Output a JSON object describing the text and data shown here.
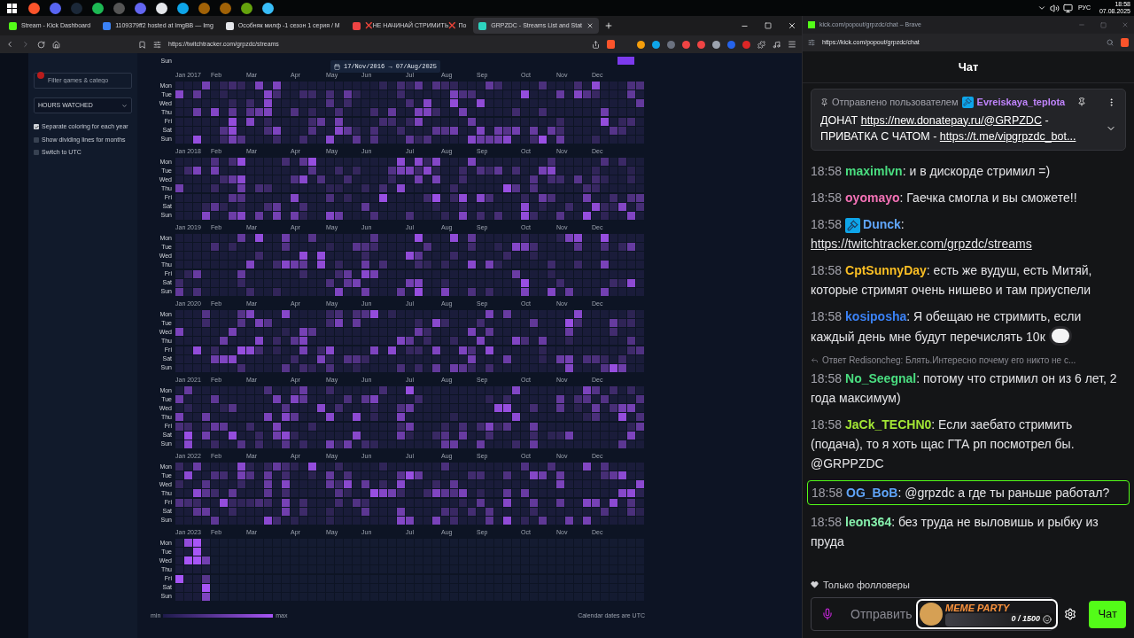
{
  "taskbar": {
    "language": "РУС",
    "time": "18:58",
    "date": "07.08.2025"
  },
  "browser": {
    "tabs": [
      {
        "title": "Stream - Kick Dashboard",
        "selected": false,
        "color": "#53fc18"
      },
      {
        "title": "1109379ff2 hosted at ImgBB — Img",
        "selected": false,
        "color": "#3b82f6"
      },
      {
        "title": "Особняк милф -1 сезон 1 серия / M",
        "selected": false,
        "color": "#e5e7eb"
      },
      {
        "title": "❌НЕ НАЧИНАЙ СТРИМИТЬ❌ По",
        "selected": false,
        "color": "#ef4444"
      },
      {
        "title": "GRPZDC - Streams List and Stat",
        "selected": true,
        "color": "#2dd4bf"
      }
    ],
    "url": "https://twitchtracker.com/grpzdc/streams"
  },
  "sidebar": {
    "filter_placeholder": "Filter games & catego",
    "metric": "HOURS WATCHED",
    "options": [
      {
        "label": "Separate coloring for each year",
        "checked": true
      },
      {
        "label": "Show dividing lines for months",
        "checked": false
      },
      {
        "label": "Switch to UTC",
        "checked": false
      }
    ]
  },
  "calendar": {
    "date_range": "17/Nov/2016 → 07/Aug/2025",
    "tail_day": "Sun",
    "years": [
      {
        "kind": "full",
        "months": [
          "Jan 2017",
          "Feb",
          "Mar",
          "Apr",
          "May",
          "Jun",
          "Jul",
          "Aug",
          "Sep",
          "Oct",
          "Nov",
          "Dec"
        ],
        "days": [
          "Mon",
          "Tue",
          "Wed",
          "Thu",
          "Fri",
          "Sat",
          "Sun"
        ]
      },
      {
        "kind": "full",
        "months": [
          "Jan 2018",
          "Feb",
          "Mar",
          "Apr",
          "May",
          "Jun",
          "Jul",
          "Aug",
          "Sep",
          "Oct",
          "Nov",
          "Dec"
        ],
        "days": [
          "Mon",
          "Tue",
          "Wed",
          "Thu",
          "Fri",
          "Sat",
          "Sun"
        ]
      },
      {
        "kind": "full",
        "months": [
          "Jan 2019",
          "Feb",
          "Mar",
          "Apr",
          "May",
          "Jun",
          "Jul",
          "Aug",
          "Sep",
          "Oct",
          "Nov",
          "Dec"
        ],
        "days": [
          "Mon",
          "Tue",
          "Wed",
          "Thu",
          "Fri",
          "Sat",
          "Sun"
        ]
      },
      {
        "kind": "full",
        "months": [
          "Jan 2020",
          "Feb",
          "Mar",
          "Apr",
          "May",
          "Jun",
          "Jul",
          "Aug",
          "Sep",
          "Oct",
          "Nov",
          "Dec"
        ],
        "days": [
          "Mon",
          "Tue",
          "Wed",
          "Thu",
          "Fri",
          "Sat",
          "Sun"
        ]
      },
      {
        "kind": "full",
        "months": [
          "Jan 2021",
          "Feb",
          "Mar",
          "Apr",
          "May",
          "Jun",
          "Jul",
          "Aug",
          "Sep",
          "Oct",
          "Nov",
          "Dec"
        ],
        "days": [
          "Mon",
          "Tue",
          "Wed",
          "Thu",
          "Fri",
          "Sat",
          "Sun"
        ]
      },
      {
        "kind": "full",
        "months": [
          "Jan 2022",
          "Feb",
          "Mar",
          "Apr",
          "May",
          "Jun",
          "Jul",
          "Aug",
          "Sep",
          "Oct",
          "Nov",
          "Dec"
        ],
        "days": [
          "Mon",
          "Tue",
          "Wed",
          "Thu",
          "Fri",
          "Sat",
          "Sun"
        ]
      },
      {
        "kind": "partial",
        "months": [
          "Jan 2023",
          "Feb",
          "Mar",
          "Apr",
          "May",
          "Jun",
          "Jul",
          "Aug",
          "Sep",
          "Oct",
          "Nov",
          "Dec"
        ],
        "days": [
          "Mon",
          "Tue",
          "Wed",
          "Thu",
          "Fri",
          "Sat",
          "Sun"
        ]
      }
    ],
    "legend_min": "min",
    "legend_max": "max",
    "note": "Calendar dates are UTC"
  },
  "chat": {
    "window_title": "kick.com/popout/grpzdc/chat – Brave",
    "url": "https://kick.com/popout/grpzdc/chat",
    "header": "Чат",
    "pinned": {
      "prefix": "Отправлено пользователем",
      "user": "Evreiskaya_teplota",
      "parts": [
        {
          "kind": "text",
          "text": "ДОНАТ "
        },
        {
          "kind": "link",
          "text": "https://new.donatepay.ru/@GRPZDC"
        },
        {
          "kind": "text",
          "text": " - ПРИВАТКА С ЧАТОМ - "
        },
        {
          "kind": "link",
          "text": "https://t.me/vipgrpzdc_bot..."
        }
      ]
    },
    "messages": [
      {
        "time": "18:58",
        "user": "maximlvn",
        "color": "#4ade80",
        "text": ": и в дискорде стримил =)",
        "badge": false,
        "highlighted": false
      },
      {
        "time": "18:58",
        "user": "oyomayo",
        "color": "#f472b6",
        "text": ": Гаечка смогла и вы сможете!!",
        "badge": false,
        "highlighted": false
      },
      {
        "time": "18:58",
        "user": "Dunck",
        "color": "#60a5fa",
        "text": ":",
        "link": "https://twitchtracker.com/grpzdc/streams",
        "badge": true,
        "highlighted": false
      },
      {
        "time": "18:58",
        "user": "CptSunnyDay",
        "color": "#fbbf24",
        "text": ": есть же вудуш, есть Митяй, которые стримят очень нишево и там приуспели",
        "badge": false,
        "highlighted": false
      },
      {
        "time": "18:58",
        "user": "kosiposha",
        "color": "#3b82f6",
        "text": ": Я обещаю не стримить, если каждый день мне будут перечислять 10к",
        "emote": true,
        "badge": false,
        "highlighted": false
      },
      {
        "time": "18:58",
        "user": "No_Seegnal",
        "color": "#4ade80",
        "text": ": потому что стримил он из 6 лет, 2 года максимум)",
        "reply": "Ответ Redisoncheg: Блять.Интересно почему его никто не с...",
        "badge": false,
        "highlighted": false
      },
      {
        "time": "18:58",
        "user": "JaCk_TECHN0",
        "color": "#a3e635",
        "text": ": Если заебато стримить (подача), то я хоть щас ГТА рп посмотрел бы. @GRPPZDC",
        "badge": false,
        "highlighted": false
      },
      {
        "time": "18:58",
        "user": "OG_BoB",
        "color": "#60a5fa",
        "text": ": @grpzdc а где ты раньше работал?",
        "badge": false,
        "highlighted": true
      },
      {
        "time": "18:58",
        "user": "leon364",
        "color": "#86efac",
        "text": ": без труда не выловишь и рыбку из пруда",
        "badge": false,
        "highlighted": false
      }
    ],
    "followers_only": "Только фолловеры",
    "input_placeholder": "Отправить",
    "overlay": {
      "title": "MEME PARTY",
      "progress": "0 / 1500",
      "level": 0
    },
    "send_button": "Чат"
  }
}
